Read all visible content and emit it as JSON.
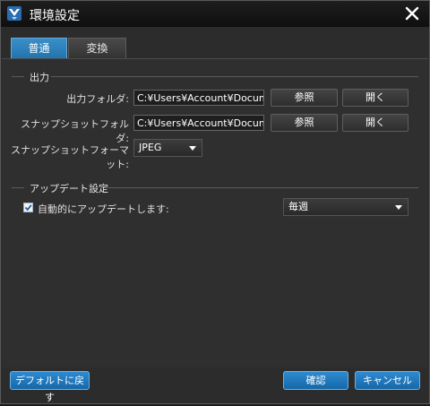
{
  "window": {
    "title": "環境設定",
    "app_icon": "bird-logo-icon",
    "close_icon": "close-icon"
  },
  "tabs": [
    {
      "label": "普通",
      "active": true
    },
    {
      "label": "変換",
      "active": false
    }
  ],
  "output": {
    "section_title": "出力",
    "output_folder": {
      "label": "出力フォルダ:",
      "value": "C:¥Users¥Account¥Docume",
      "browse": "参照",
      "open": "開く"
    },
    "snapshot_folder": {
      "label": "スナップショットフォルダ:",
      "value": "C:¥Users¥Account¥Docume",
      "browse": "参照",
      "open": "開く"
    },
    "snapshot_format": {
      "label": "スナップショットフォーマット:",
      "value": "JPEG"
    }
  },
  "update": {
    "section_title": "アップデート設定",
    "auto_update_label": "自動的にアップデートします:",
    "auto_update_checked": true,
    "frequency": "毎週"
  },
  "footer": {
    "reset": "デフォルトに戻す",
    "ok": "確認",
    "cancel": "キャンセル"
  },
  "colors": {
    "accent": "#2a7fc0",
    "background": "#2f2f2f",
    "titlebar": "#141414"
  }
}
